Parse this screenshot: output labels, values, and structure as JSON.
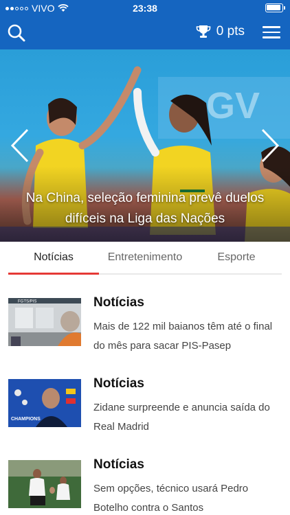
{
  "status_bar": {
    "carrier": "VIVO",
    "time": "23:38"
  },
  "header": {
    "points": "0 pts",
    "icons": [
      "search-icon",
      "trophy-icon",
      "menu-icon"
    ]
  },
  "hero": {
    "title": "Na China, seleção feminina prevê duelos difíceis na Liga das Nações"
  },
  "tabs": [
    {
      "label": "Notícias",
      "active": true
    },
    {
      "label": "Entretenimento",
      "active": false
    },
    {
      "label": "Esporte",
      "active": false
    }
  ],
  "colors": {
    "primary": "#1565c0",
    "accent": "#e53935"
  },
  "news": [
    {
      "category": "Notícias",
      "text": "Mais de 122 mil baianos têm até o final do mês para sacar PIS-Pasep"
    },
    {
      "category": "Notícias",
      "text": "Zidane surpreende e anuncia saída do Real Madrid"
    },
    {
      "category": "Notícias",
      "text": "Sem opções, técnico usará Pedro Botelho contra o Santos"
    }
  ]
}
